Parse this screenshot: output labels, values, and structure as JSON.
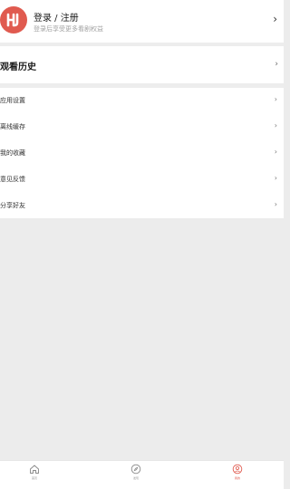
{
  "login": {
    "title": "登录 / 注册",
    "subtitle": "登录后享受更多看剧权益",
    "chevron": "›"
  },
  "history": {
    "label": "观看历史",
    "chevron": "›"
  },
  "menu": {
    "items": [
      {
        "label": "应用设置",
        "chevron": "›"
      },
      {
        "label": "离线缓存",
        "chevron": "›"
      },
      {
        "label": "我的收藏",
        "chevron": "›"
      },
      {
        "label": "意见反馈",
        "chevron": "›"
      },
      {
        "label": "分享好友",
        "chevron": "›"
      }
    ]
  },
  "tabbar": {
    "tabs": [
      {
        "label": "首页",
        "icon": "home-icon",
        "active": false
      },
      {
        "label": "发现",
        "icon": "compass-icon",
        "active": false
      },
      {
        "label": "我的",
        "icon": "user-icon",
        "active": true
      }
    ]
  },
  "colors": {
    "accent": "#e05a4f",
    "background": "#ececec"
  }
}
